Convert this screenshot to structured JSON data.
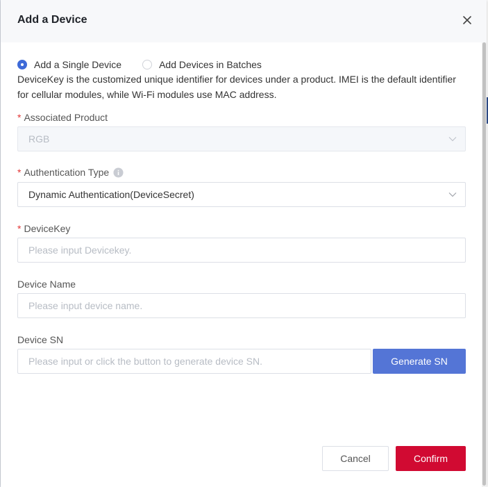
{
  "dialog": {
    "title": "Add a Device"
  },
  "mode": {
    "options": [
      "Add a Single Device",
      "Add Devices in Batches"
    ],
    "selected": "Add a Single Device"
  },
  "description": "DeviceKey is the customized unique identifier for devices under a product. IMEI is the default identifier for cellular modules, while Wi-Fi modules use MAC address.",
  "fields": {
    "associated_product": {
      "required_mark": "*",
      "label": "Associated Product",
      "value": "RGB"
    },
    "auth_type": {
      "required_mark": "*",
      "label": "Authentication Type",
      "value": "Dynamic Authentication(DeviceSecret)"
    },
    "device_key": {
      "required_mark": "*",
      "label": "DeviceKey",
      "value": "",
      "placeholder": "Please input Devicekey."
    },
    "device_name": {
      "label": "Device Name",
      "value": "",
      "placeholder": "Please input device name."
    },
    "device_sn": {
      "label": "Device SN",
      "value": "",
      "placeholder": "Please input or click the button to generate device SN."
    }
  },
  "buttons": {
    "generate_sn": "Generate SN",
    "cancel": "Cancel",
    "confirm": "Confirm"
  },
  "icons": {
    "close": "close-icon",
    "info": "info-icon",
    "chevron": "chevron-down-icon"
  },
  "colors": {
    "primary": "#5475d6",
    "radio_checked": "#3e6ad8",
    "confirm": "#d10a32",
    "required": "#e23636"
  }
}
